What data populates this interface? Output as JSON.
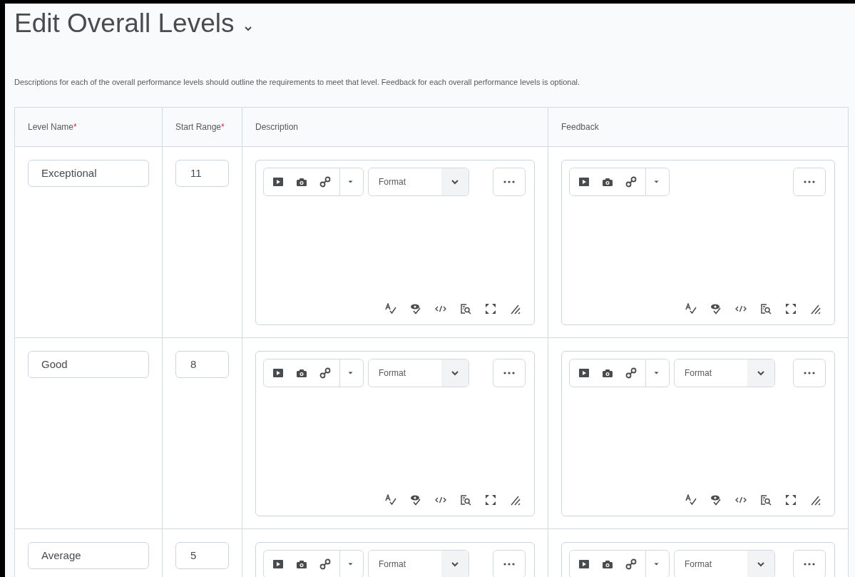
{
  "title": "Edit Overall Levels",
  "intro": "Descriptions for each of the overall performance levels should outline the requirements to meet that level. Feedback for each overall performance levels is optional.",
  "columns": [
    {
      "label": "Level Name",
      "required_mark": "*"
    },
    {
      "label": "Start Range",
      "required_mark": "*"
    },
    {
      "label": "Description"
    },
    {
      "label": "Feedback"
    }
  ],
  "rows": [
    {
      "level_name": "Exceptional",
      "start_range": "11",
      "description_editor": {
        "format": "Format"
      },
      "feedback_editor": {}
    },
    {
      "level_name": "Good",
      "start_range": "8",
      "description_editor": {
        "format": "Format"
      },
      "feedback_editor": {
        "format": "Format"
      }
    },
    {
      "level_name": "Average",
      "start_range": "5",
      "description_editor": {
        "format": "Format"
      },
      "feedback_editor": {
        "format": "Format"
      }
    }
  ]
}
